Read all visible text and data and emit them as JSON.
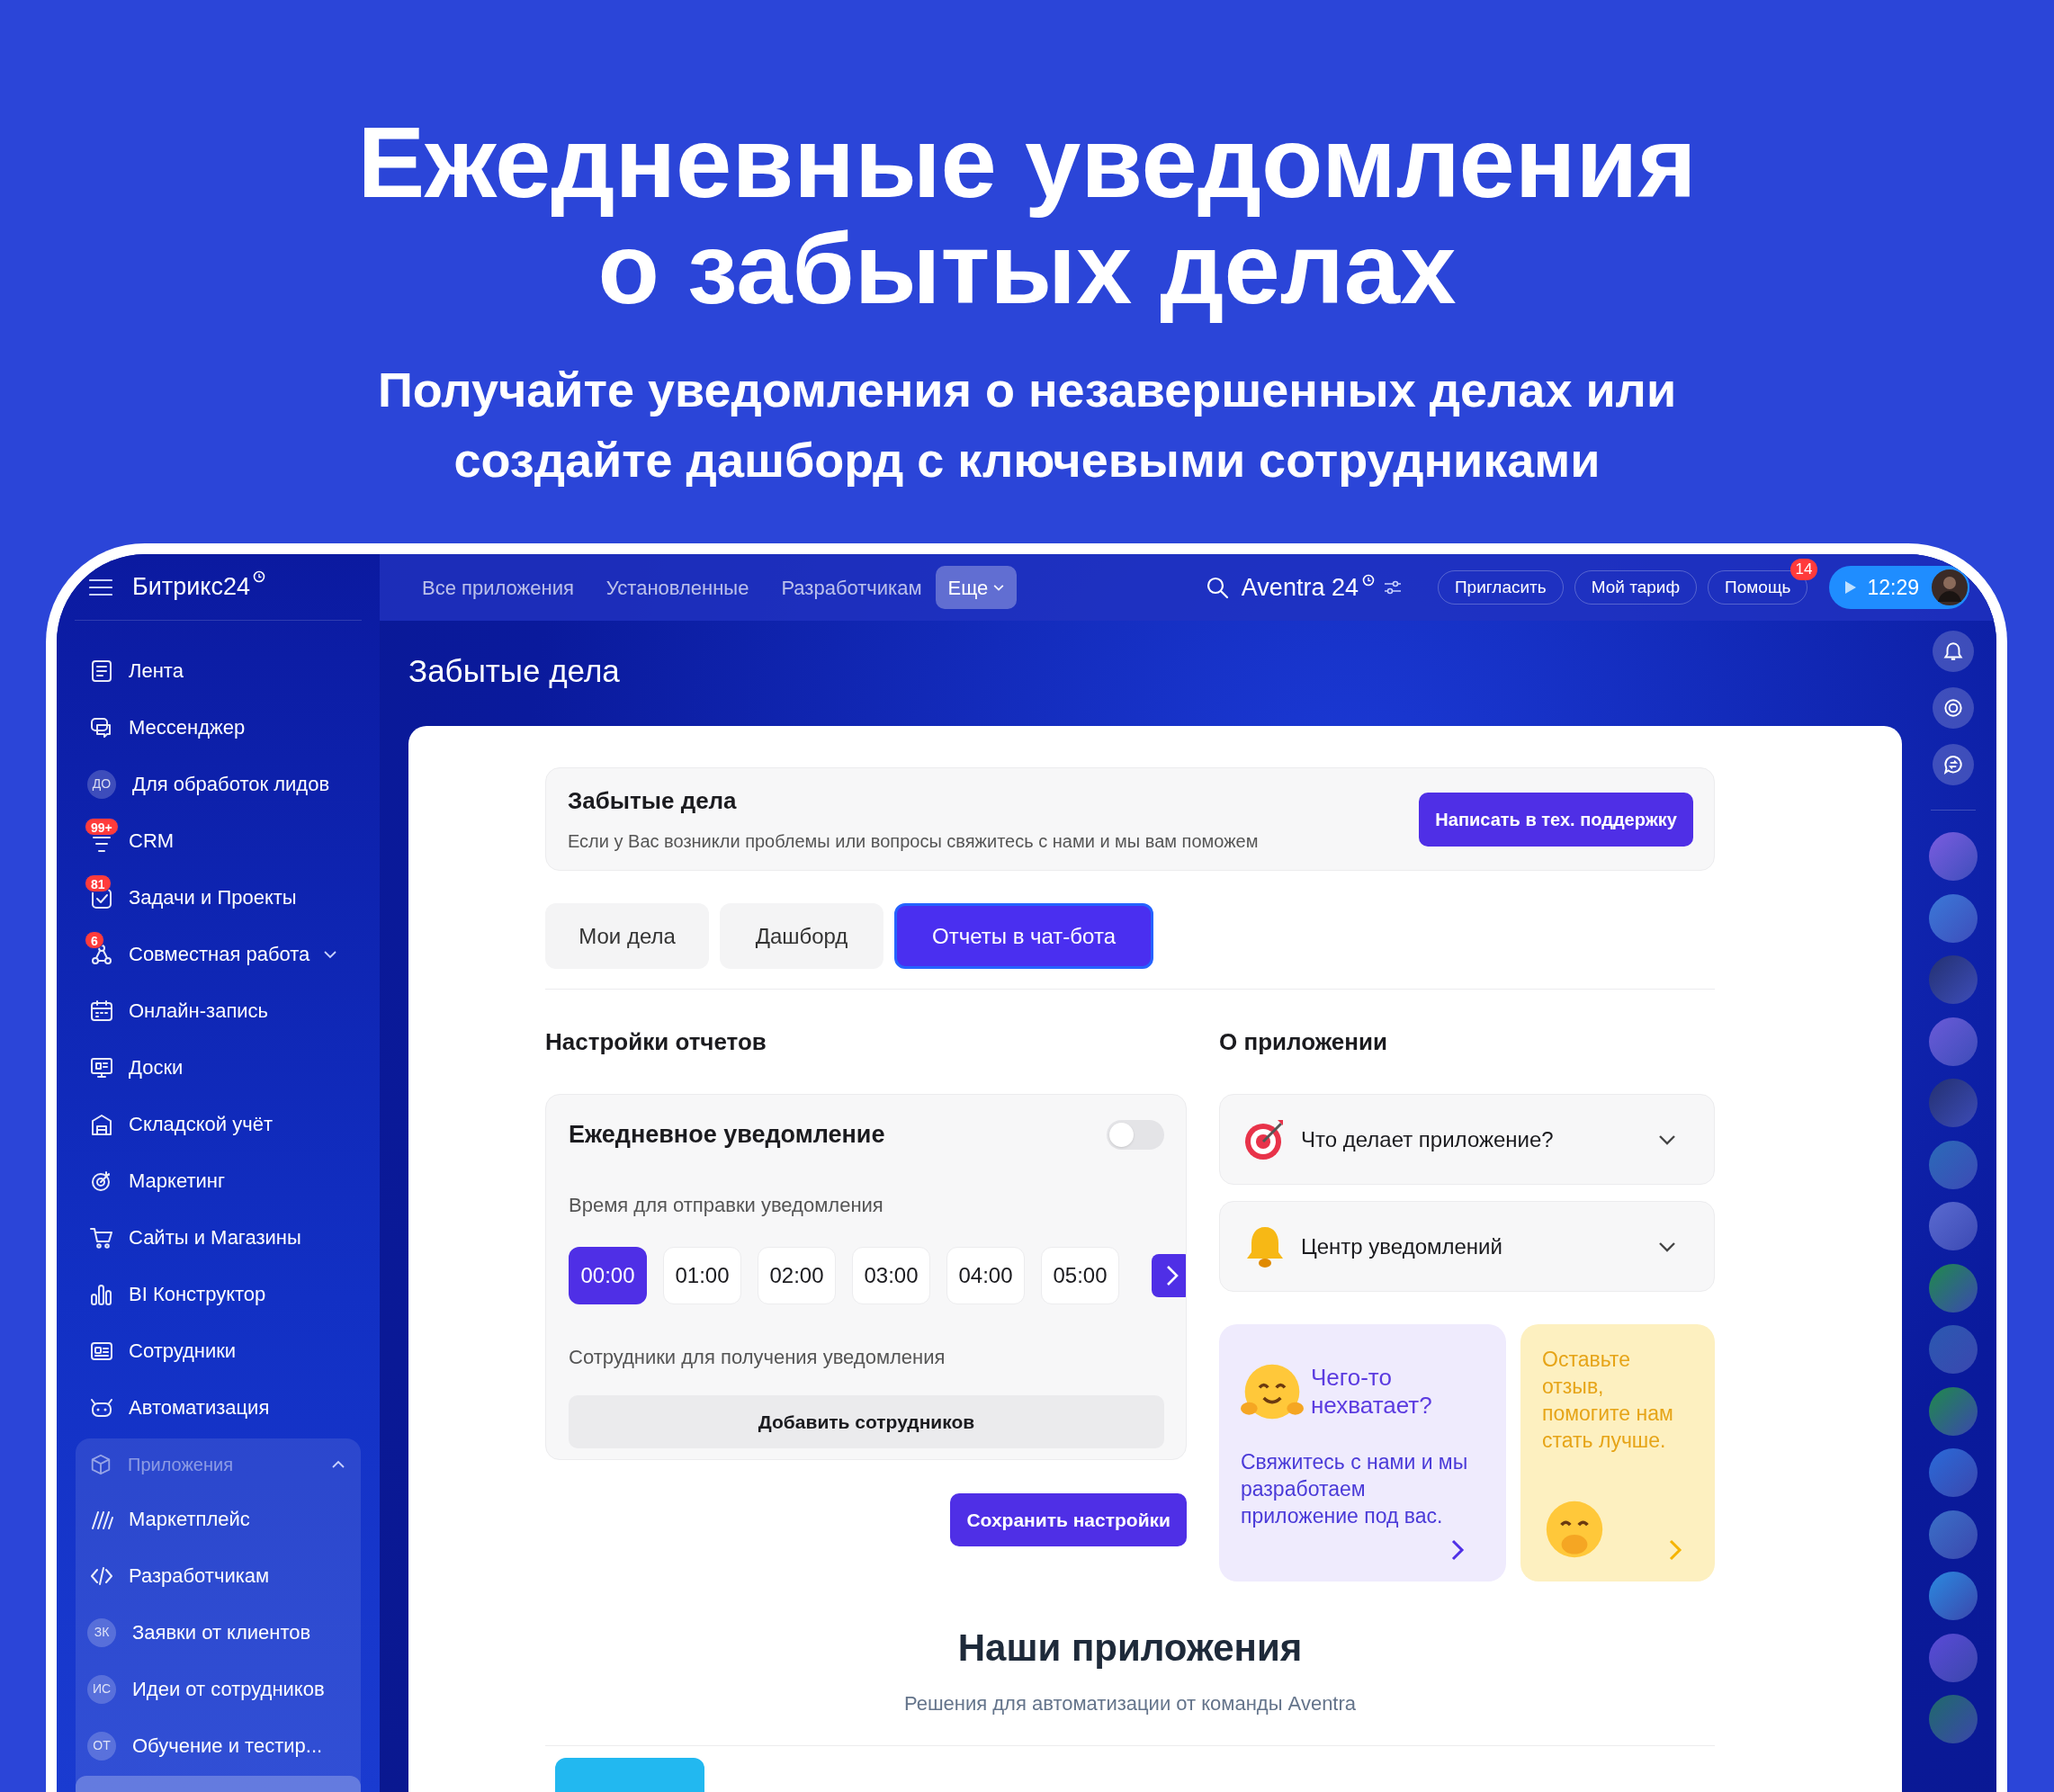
{
  "headline": {
    "title_lines": [
      "Ежедневные уведомления",
      "о забытых делах"
    ],
    "subtitle_lines": [
      "Получайте уведомления о незавершенных делах или",
      "создайте дашборд с ключевыми сотрудниками"
    ]
  },
  "app": {
    "logo": "Битрикс24",
    "top_nav": [
      {
        "label": "Все приложения",
        "selected": false
      },
      {
        "label": "Установленные",
        "selected": false
      },
      {
        "label": "Разработчикам",
        "selected": false
      },
      {
        "label": "Еще",
        "selected": true
      }
    ],
    "portal_name": "Aventra 24",
    "header_buttons": [
      {
        "label": "Пригласить"
      },
      {
        "label": "Мой тариф"
      },
      {
        "label": "Помощь",
        "badge": "14"
      }
    ],
    "time": "12:29",
    "sidebar": {
      "items": [
        {
          "kind": "icon",
          "label": "Лента"
        },
        {
          "kind": "icon",
          "label": "Мессенджер"
        },
        {
          "kind": "avatar",
          "avatar": "ДО",
          "label": "Для обработок лидов"
        },
        {
          "kind": "icon",
          "label": "CRM",
          "badge": "99+"
        },
        {
          "kind": "icon",
          "label": "Задачи и Проекты",
          "badge": "81"
        },
        {
          "kind": "icon",
          "label": "Совместная работа",
          "badge": "6",
          "expanded": false
        },
        {
          "kind": "icon",
          "label": "Онлайн-запись"
        },
        {
          "kind": "icon",
          "label": "Доски"
        },
        {
          "kind": "icon",
          "label": "Складской учёт"
        },
        {
          "kind": "icon",
          "label": "Маркетинг"
        },
        {
          "kind": "icon",
          "label": "Сайты и Магазины"
        },
        {
          "kind": "icon",
          "label": "BI Конструктор"
        },
        {
          "kind": "icon",
          "label": "Сотрудники"
        },
        {
          "kind": "icon",
          "label": "Автоматизация"
        }
      ],
      "group": {
        "label": "Приложения",
        "expanded": true,
        "items": [
          {
            "kind": "icon",
            "label": "Маркетплейс"
          },
          {
            "kind": "icon",
            "label": "Разработчикам"
          },
          {
            "kind": "avatar",
            "avatar": "ЗК",
            "label": "Заявки от клиентов"
          },
          {
            "kind": "avatar",
            "avatar": "ИС",
            "label": "Идеи от сотрудников"
          },
          {
            "kind": "avatar",
            "avatar": "ОТ",
            "label": "Обучение и тестир..."
          }
        ]
      }
    },
    "page_title": "Забытые дела",
    "info": {
      "title": "Забытые дела",
      "text": "Если у Вас возникли проблемы или вопросы свяжитесь с нами и мы вам поможем",
      "button": "Написать в тех. поддержку"
    },
    "tabs": [
      {
        "label": "Мои дела",
        "selected": false
      },
      {
        "label": "Дашборд",
        "selected": false
      },
      {
        "label": "Отчеты в чат-бота",
        "selected": true
      }
    ],
    "settings": {
      "title": "Настройки отчетов",
      "card_title": "Ежедневное уведомление",
      "on": false,
      "time_label": "Время для отправки уведомления",
      "times": [
        {
          "label": "00:00",
          "selected": true
        },
        {
          "label": "01:00",
          "selected": false
        },
        {
          "label": "02:00",
          "selected": false
        },
        {
          "label": "03:00",
          "selected": false
        },
        {
          "label": "04:00",
          "selected": false
        },
        {
          "label": "05:00",
          "selected": false
        }
      ],
      "employees_label": "Сотрудники для получения уведомления",
      "add_button": "Добавить сотрудников",
      "save_button": "Сохранить настройки"
    },
    "about": {
      "title": "О приложении",
      "items": [
        {
          "kind": "target",
          "label": "Что делает приложение?",
          "expanded": false
        },
        {
          "kind": "bell",
          "label": "Центр уведомлений",
          "expanded": false
        }
      ]
    },
    "cards": [
      {
        "kind": "request",
        "title": "Чего-то нехватает?",
        "text": "Свяжитесь с нами и мы разработаем приложение под вас."
      },
      {
        "kind": "feedback",
        "text": "Оставьте отзыв, помогите нам стать лучше."
      }
    ],
    "apps_section": {
      "title": "Наши приложения",
      "subtitle": "Решения для автоматизации от команды Aventra"
    }
  }
}
